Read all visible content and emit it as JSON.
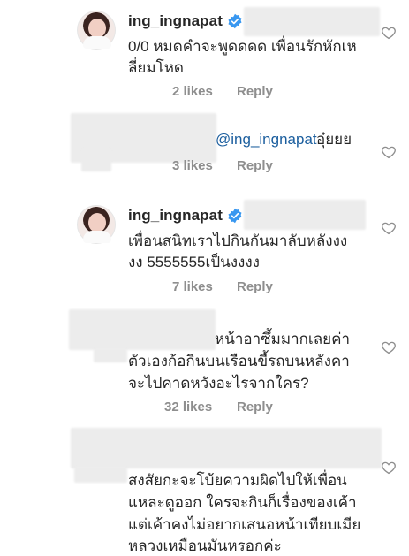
{
  "comments": [
    {
      "username": "ing_ingnapat",
      "lines": [
        "0/0 หมดคำจะพูดดดด เพื่อนรักหักเห",
        "ลี่ยมโหด"
      ],
      "likes": "2 likes",
      "reply": "Reply"
    },
    {
      "username": "",
      "mention": "@ing_ingnapat",
      "lines": [
        " อุ๋ยยย"
      ],
      "likes": "3 likes",
      "reply": "Reply"
    },
    {
      "username": "ing_ingnapat",
      "lines": [
        "เพื่อนสนิทเราไปกินกันมาลับหลังงง",
        "งง 5555555เป็นงงงง"
      ],
      "likes": "7 likes",
      "reply": "Reply"
    },
    {
      "username": "",
      "lines": [
        "หน้าอาซึ้มมากเลยค่า",
        "ตัวเองก้อกินบนเรือนขี้รถบนหลังคา",
        "จะไปคาดหวังอะไรจากใคร?"
      ],
      "likes": "32 likes",
      "reply": "Reply"
    },
    {
      "username": "",
      "lines": [
        "สงสัยกะจะโบ้ยความผิดไปให้เพื่อน",
        "แหละดูออก ใครจะกินก็เรื่องของเค้า",
        "แต่เค้าคงไม่อยากเสนอหน้าเทียบเมีย",
        "หลวงเหมือนมันหรอกค่ะ"
      ],
      "likes": "",
      "reply": ""
    }
  ],
  "icons": {
    "verified": "verified-badge-icon",
    "like": "heart-outline-icon"
  },
  "colors": {
    "verified": "#3897f0",
    "meta": "#8e8e8e",
    "mention": "#1b5e9e"
  }
}
